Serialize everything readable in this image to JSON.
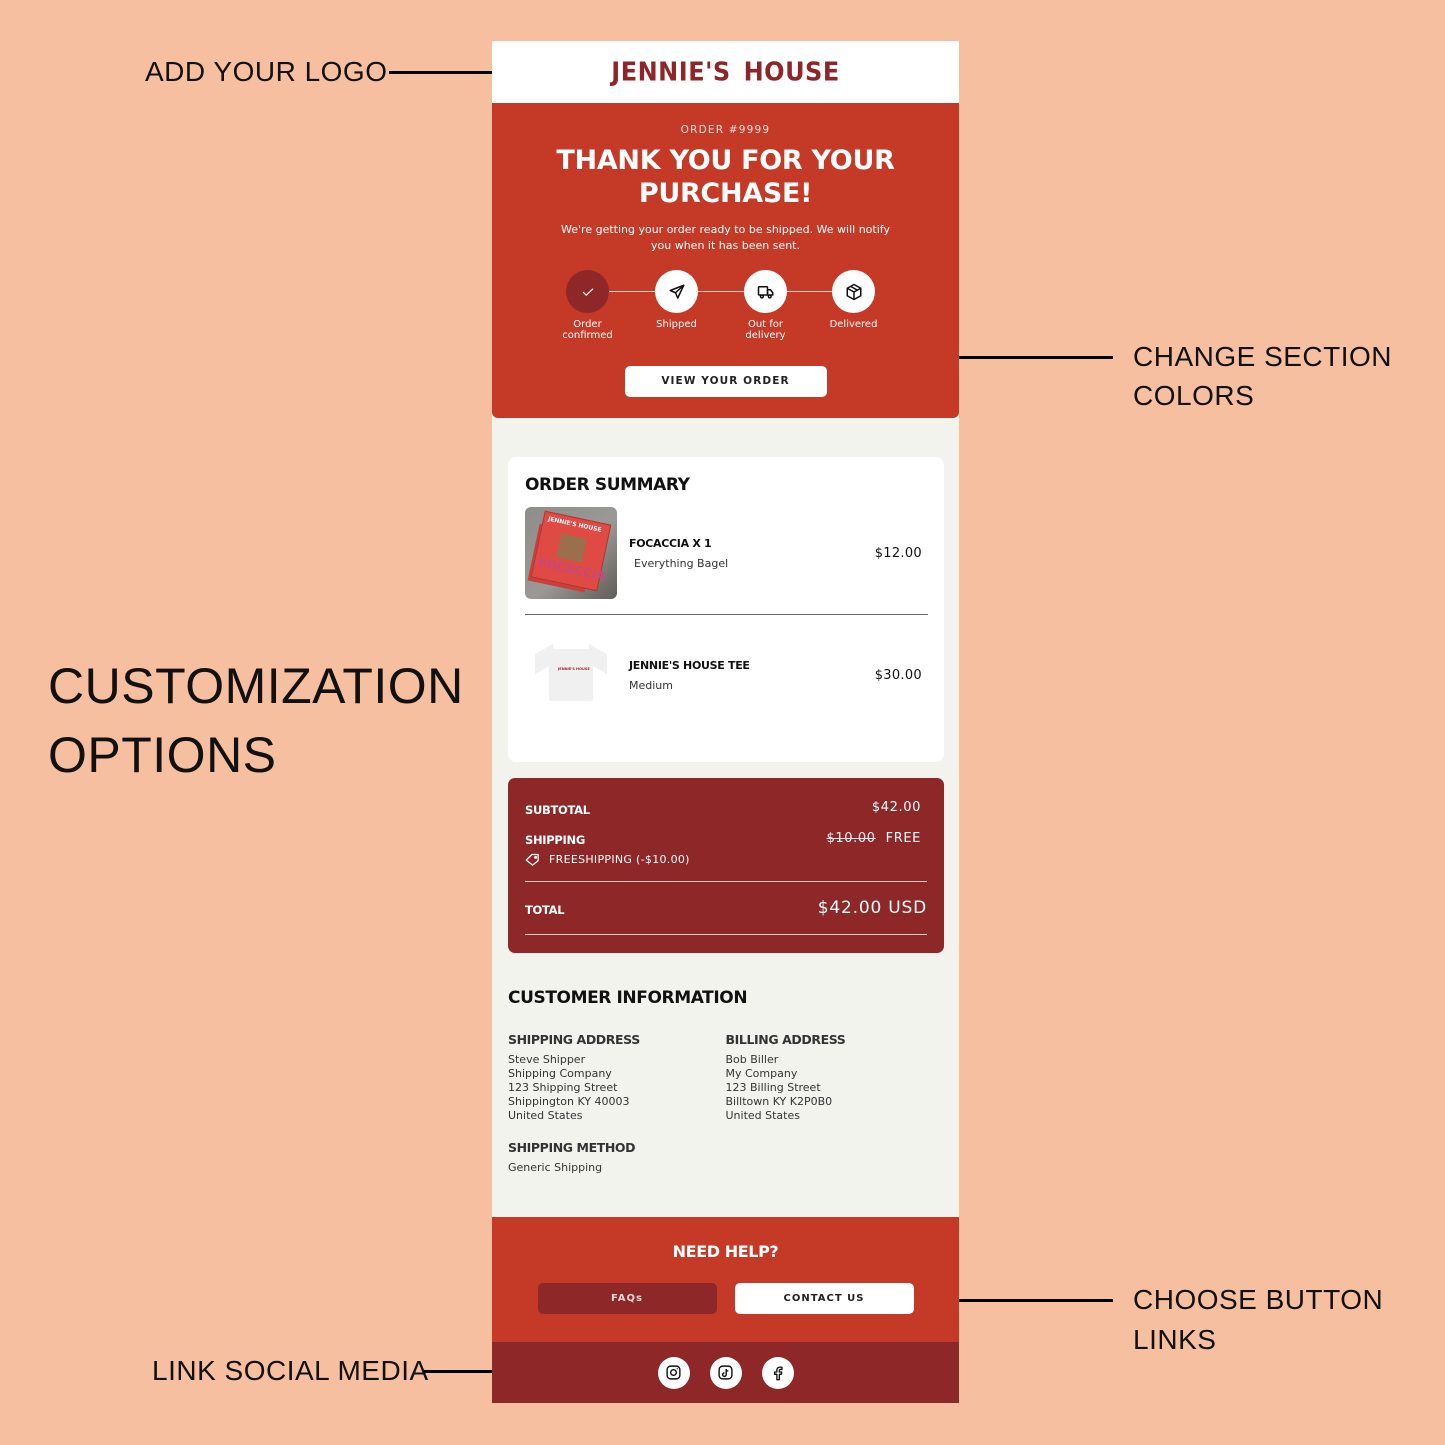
{
  "annotations": {
    "add_logo": "ADD YOUR LOGO",
    "change_colors_line1": "CHANGE SECTION",
    "change_colors_line2": "COLORS",
    "customization_line1": "CUSTOMIZATION",
    "customization_line2": "OPTIONS",
    "choose_links_line1": "CHOOSE BUTTON",
    "choose_links_line2": "LINKS",
    "link_social": "LINK SOCIAL MEDIA"
  },
  "colors": {
    "background": "#f6bfa0",
    "primary_red": "#c43a27",
    "dark_red": "#8d2728",
    "email_bg": "#f3f3ee"
  },
  "header": {
    "logo_text": "JENNIE'S HOUSE"
  },
  "hero": {
    "order_number": "ORDER #9999",
    "title_line1": "THANK YOU FOR YOUR",
    "title_line2": "PURCHASE!",
    "subtitle": "We're getting your order ready to be shipped. We will notify you when it has been sent.",
    "steps": [
      {
        "icon": "check-icon",
        "label_line1": "Order",
        "label_line2": "confirmed",
        "status": "complete"
      },
      {
        "icon": "send-icon",
        "label_line1": "Shipped",
        "label_line2": "",
        "status": "pending"
      },
      {
        "icon": "truck-icon",
        "label_line1": "Out for",
        "label_line2": "delivery",
        "status": "pending"
      },
      {
        "icon": "package-icon",
        "label_line1": "Delivered",
        "label_line2": "",
        "status": "pending"
      }
    ],
    "cta_label": "VIEW YOUR ORDER"
  },
  "order_summary": {
    "title": "ORDER SUMMARY",
    "items": [
      {
        "name": "FOCACCIA X 1",
        "variant": "Everything Bagel",
        "price": "$12.00",
        "image_alt": "Focaccia box",
        "image_text_top": "JENNIE'S HOUSE",
        "image_text_bottom": "FOCACCIA"
      },
      {
        "name": "JENNIE'S HOUSE TEE",
        "variant": "Medium",
        "price": "$30.00",
        "image_alt": "White tee",
        "image_text": "JENNIE'S HOUSE"
      }
    ]
  },
  "totals": {
    "subtotal_label": "SUBTOTAL",
    "subtotal_value": "$42.00",
    "shipping_label": "SHIPPING",
    "shipping_original": "$10.00",
    "shipping_value": "FREE",
    "discount_code": "FREESHIPPING (-$10.00)",
    "total_label": "TOTAL",
    "total_value": "$42.00 USD"
  },
  "customer": {
    "title": "CUSTOMER INFORMATION",
    "shipping_address": {
      "label": "SHIPPING ADDRESS",
      "lines": [
        "Steve Shipper",
        "Shipping Company",
        "123 Shipping Street",
        "Shippington KY 40003",
        "United States"
      ]
    },
    "billing_address": {
      "label": "BILLING ADDRESS",
      "lines": [
        "Bob Biller",
        "My Company",
        "123 Billing Street",
        "Billtown KY K2P0B0",
        "United States"
      ]
    },
    "shipping_method": {
      "label": "SHIPPING METHOD",
      "value": "Generic Shipping"
    }
  },
  "help": {
    "title": "NEED HELP?",
    "faq_label": "FAQs",
    "contact_label": "CONTACT US"
  },
  "social": [
    "instagram-icon",
    "tiktok-icon",
    "facebook-icon"
  ]
}
